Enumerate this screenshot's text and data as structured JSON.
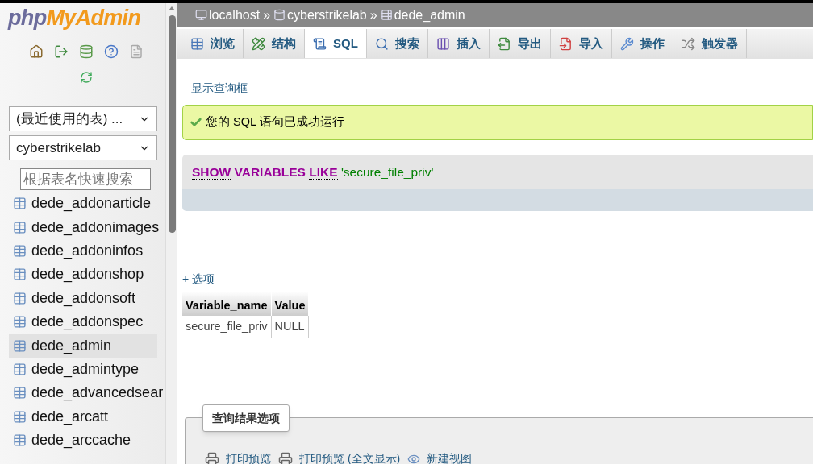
{
  "logo": {
    "prefix": "php",
    "name": "MyAdmin"
  },
  "sidebar": {
    "recent_select": "(最近使用的表) ...",
    "database_select": "cyberstrikelab",
    "filter": {
      "placeholder": "根据表名快速搜索"
    },
    "tables": [
      {
        "name": "dede_addonarticle",
        "selected": false
      },
      {
        "name": "dede_addonimages",
        "selected": false
      },
      {
        "name": "dede_addoninfos",
        "selected": false
      },
      {
        "name": "dede_addonshop",
        "selected": false
      },
      {
        "name": "dede_addonsoft",
        "selected": false
      },
      {
        "name": "dede_addonspec",
        "selected": false
      },
      {
        "name": "dede_admin",
        "selected": true
      },
      {
        "name": "dede_admintype",
        "selected": false
      },
      {
        "name": "dede_advancedsear",
        "selected": false
      },
      {
        "name": "dede_arcatt",
        "selected": false
      },
      {
        "name": "dede_arccache",
        "selected": false
      }
    ]
  },
  "breadcrumb": [
    {
      "label": "localhost",
      "kind": "server",
      "separator": "»"
    },
    {
      "label": "cyberstrikelab",
      "kind": "database",
      "separator": "»"
    },
    {
      "label": "dede_admin",
      "kind": "table"
    }
  ],
  "tabs": [
    {
      "label": "浏览",
      "selected": false
    },
    {
      "label": "结构",
      "selected": false
    },
    {
      "label": "SQL",
      "selected": true
    },
    {
      "label": "搜索",
      "selected": false
    },
    {
      "label": "插入",
      "selected": false
    },
    {
      "label": "导出",
      "selected": false
    },
    {
      "label": "导入",
      "selected": false
    },
    {
      "label": "操作",
      "selected": false
    },
    {
      "label": "触发器",
      "selected": false
    }
  ],
  "show_query_link": "显示查询框",
  "success_message": "您的 SQL 语句已成功运行",
  "query": [
    {
      "text": "SHOW",
      "kind": "keyword",
      "linked": true
    },
    {
      "text": "VARIABLES",
      "kind": "keyword",
      "linked": false
    },
    {
      "text": "LIKE",
      "kind": "keyword",
      "linked": true
    },
    {
      "text": "'secure_file_priv'",
      "kind": "string",
      "linked": false
    }
  ],
  "options_link": "+ 选项",
  "table": {
    "columns": [
      "Variable_name",
      "Value"
    ],
    "rows": [
      [
        "secure_file_priv",
        "NULL"
      ]
    ]
  },
  "result_options": {
    "title": "查询结果选项",
    "actions": [
      {
        "label": "打印预览",
        "kind": "print"
      },
      {
        "label": "打印预览 (全文显示)",
        "kind": "print"
      },
      {
        "label": "新建视图",
        "kind": "view"
      }
    ]
  }
}
